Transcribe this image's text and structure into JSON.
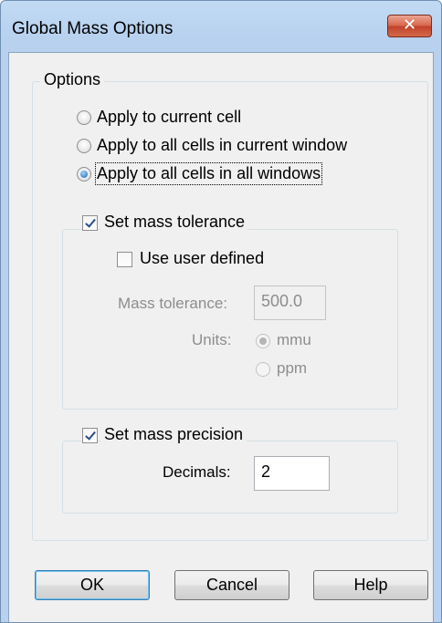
{
  "dialog": {
    "title": "Global Mass Options",
    "close_glyph": "✕"
  },
  "options": {
    "legend": "Options",
    "radios": [
      {
        "label": "Apply to current cell",
        "checked": false
      },
      {
        "label": "Apply to all cells in current window",
        "checked": false
      },
      {
        "label": "Apply to all cells in all windows",
        "checked": true
      }
    ]
  },
  "tolerance": {
    "legend": "Set mass tolerance",
    "checked": true,
    "use_user_defined": {
      "label": "Use user defined",
      "checked": false
    },
    "mass_tolerance_label": "Mass tolerance:",
    "mass_tolerance_value": "500.0",
    "units_label": "Units:",
    "units": [
      {
        "label": "mmu",
        "checked": true
      },
      {
        "label": "ppm",
        "checked": false
      }
    ]
  },
  "precision": {
    "legend": "Set mass precision",
    "checked": true,
    "decimals_label": "Decimals:",
    "decimals_value": "2"
  },
  "buttons": {
    "ok": "OK",
    "cancel": "Cancel",
    "help": "Help"
  },
  "icons": {
    "close": "close-icon",
    "radio": "radio-button-icon",
    "checkbox": "checkbox-icon"
  }
}
